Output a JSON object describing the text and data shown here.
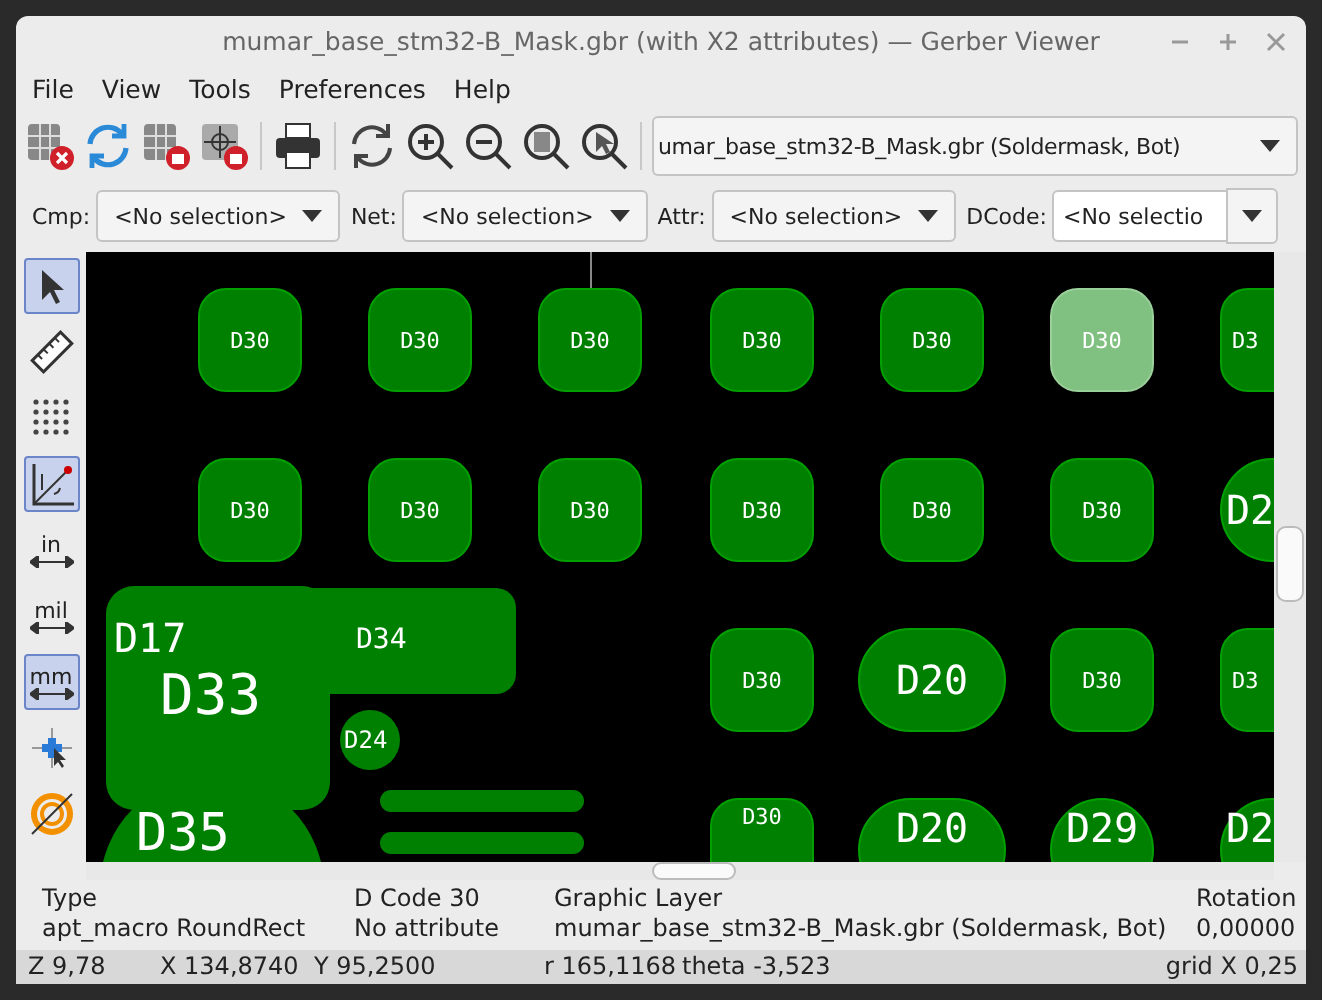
{
  "window": {
    "title": "mumar_base_stm32-B_Mask.gbr (with X2 attributes) — Gerber Viewer"
  },
  "menu": [
    "File",
    "View",
    "Tools",
    "Preferences",
    "Help"
  ],
  "toolbar": {
    "layer_select": "umar_base_stm32-B_Mask.gbr (Soldermask, Bot)"
  },
  "filters": [
    {
      "kind": "dropdown",
      "label": "Cmp:",
      "value": "<No selection>"
    },
    {
      "kind": "dropdown",
      "label": "Net:",
      "value": "<No selection>"
    },
    {
      "kind": "dropdown",
      "label": "Attr:",
      "value": "<No selection>"
    },
    {
      "kind": "field",
      "label": "DCode:",
      "value": "<No selectio"
    }
  ],
  "side_tools": [
    {
      "kind": "pointer",
      "selected": true
    },
    {
      "kind": "ruler",
      "selected": false
    },
    {
      "kind": "grid",
      "selected": false
    },
    {
      "kind": "polar",
      "selected": true
    },
    {
      "kind": "unit",
      "label": "in",
      "selected": false
    },
    {
      "kind": "unit",
      "label": "mil",
      "selected": false
    },
    {
      "kind": "unit",
      "label": "mm",
      "selected": true
    },
    {
      "kind": "cursor",
      "selected": false
    },
    {
      "kind": "contrast",
      "selected": false
    }
  ],
  "canvas": {
    "pad_rows": [
      [
        {
          "kind": "rect",
          "label": "D30",
          "selected": false
        },
        {
          "kind": "rect",
          "label": "D30",
          "selected": false
        },
        {
          "kind": "rect",
          "label": "D30",
          "selected": false
        },
        {
          "kind": "rect",
          "label": "D30",
          "selected": false
        },
        {
          "kind": "rect",
          "label": "D30",
          "selected": false
        },
        {
          "kind": "rect",
          "label": "D30",
          "selected": true
        },
        {
          "kind": "rect",
          "label": "D3",
          "selected": false
        }
      ],
      [
        {
          "kind": "rect",
          "label": "D30",
          "selected": false
        },
        {
          "kind": "rect",
          "label": "D30",
          "selected": false
        },
        {
          "kind": "rect",
          "label": "D30",
          "selected": false
        },
        {
          "kind": "rect",
          "label": "D30",
          "selected": false
        },
        {
          "kind": "rect",
          "label": "D30",
          "selected": false
        },
        {
          "kind": "rect",
          "label": "D30",
          "selected": false
        },
        {
          "kind": "circle",
          "label": "D2",
          "selected": false
        }
      ],
      [
        {
          "kind": "rect",
          "label": "D30",
          "selected": false
        },
        {
          "kind": "oval",
          "label": "D20",
          "selected": false
        },
        {
          "kind": "rect",
          "label": "D30",
          "selected": false
        },
        {
          "kind": "rect",
          "label": "D3",
          "selected": false
        }
      ],
      [
        {
          "kind": "rect",
          "label": "D30",
          "selected": false
        },
        {
          "kind": "oval",
          "label": "D20",
          "selected": false
        },
        {
          "kind": "circle",
          "label": "D29",
          "selected": false
        },
        {
          "kind": "circle",
          "label": "D2",
          "selected": false
        }
      ]
    ],
    "shapes": [
      {
        "kind": "block",
        "labels": [
          "D17",
          "D33"
        ]
      },
      {
        "kind": "bar",
        "labels": [
          "D34"
        ]
      },
      {
        "kind": "circle",
        "labels": [
          "D24"
        ]
      },
      {
        "kind": "big_circle",
        "labels": [
          "D35"
        ]
      },
      {
        "kind": "thin_bar"
      },
      {
        "kind": "thin_bar"
      }
    ]
  },
  "info": [
    {
      "heading": "Type",
      "value": "apt_macro RoundRect"
    },
    {
      "heading": "D Code 30",
      "value": "No attribute"
    },
    {
      "heading": "Graphic Layer",
      "value": "mumar_base_stm32-B_Mask.gbr (Soldermask, Bot)"
    },
    {
      "heading": "Rotation",
      "value": "0,00000"
    }
  ],
  "status_bar": {
    "zoom": "Z 9,78",
    "x": "X 134,8740",
    "y": "Y 95,2500",
    "r": "r 165,1168",
    "theta": "theta -3,523",
    "grid": "grid X 0,25"
  }
}
